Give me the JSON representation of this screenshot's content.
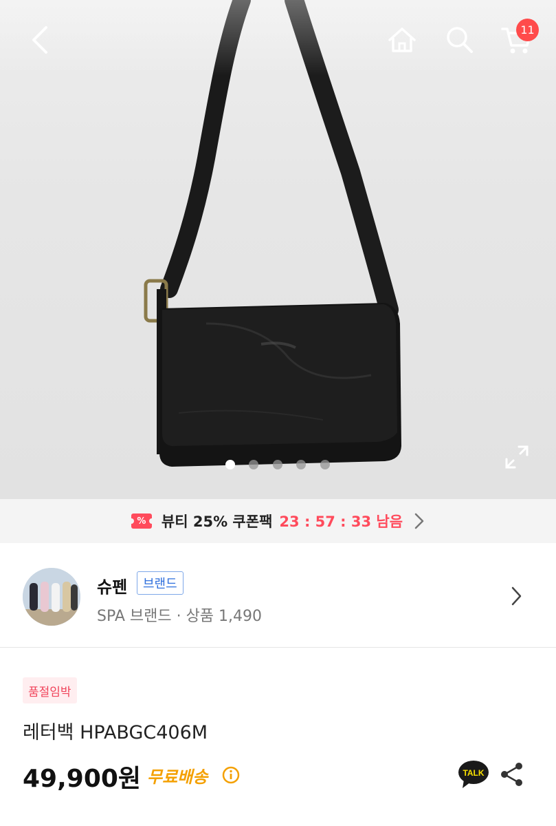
{
  "header": {
    "cart_count": "11"
  },
  "gallery": {
    "slide_count": 5,
    "active_index": 0
  },
  "coupon": {
    "icon_text": "%",
    "label": "뷰티 25% 쿠폰팩",
    "timer": "23 : 57 : 33 남음"
  },
  "store": {
    "name": "슈펜",
    "badge": "브랜드",
    "meta": "SPA 브랜드 · 상품 1,490"
  },
  "product": {
    "status_badge": "품절임박",
    "name": "레터백 HPABGC406M",
    "price": "49,900원",
    "shipping": "무료배송",
    "talk_label": "TALK"
  },
  "colors": {
    "accent": "#ff4b5c",
    "shipping": "#f4a000",
    "brand_blue": "#2f6fdd"
  }
}
